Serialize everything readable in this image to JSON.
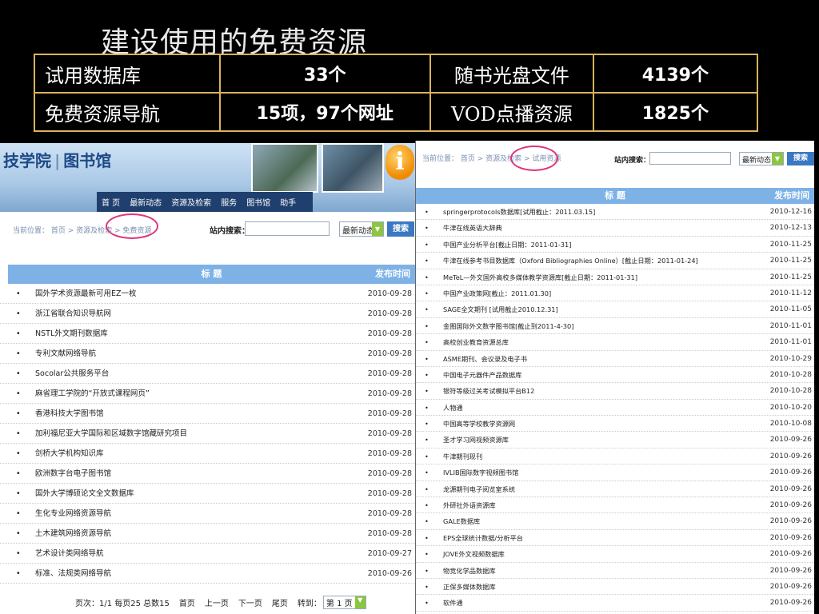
{
  "slide_title": "建设使用的免费资源",
  "stats": [
    {
      "label": "试用数据库",
      "value": "33个"
    },
    {
      "label": "随书光盘文件",
      "value": "4139个"
    },
    {
      "label": "免费资源导航",
      "value": "15项，97个网址"
    },
    {
      "label": "VOD点播资源",
      "value": "1825个"
    }
  ],
  "left": {
    "logo_text": "技学院",
    "logo_sub": "图书馆",
    "nav": [
      "首 页",
      "最新动态",
      "资源及检索",
      "服务",
      "图书馆",
      "助手"
    ],
    "breadcrumb": "当前位置： 首页 > 资源及检索 > 免费资源",
    "search_label": "站内搜索：",
    "select_value": "最新动态",
    "search_button": "搜索",
    "col_title": "标 题",
    "col_date": "发布时间",
    "rows": [
      {
        "title": "国外学术资源最新可用EZ一枚",
        "date": "2010-09-28"
      },
      {
        "title": "浙江省联合知识导航网",
        "date": "2010-09-28"
      },
      {
        "title": "NSTL外文期刊数据库",
        "date": "2010-09-28"
      },
      {
        "title": "专利文献网络导航",
        "date": "2010-09-28"
      },
      {
        "title": "Socolar公共服务平台",
        "date": "2010-09-28"
      },
      {
        "title": "麻省理工学院的“开放式课程网页”",
        "date": "2010-09-28"
      },
      {
        "title": "香港科技大学图书馆",
        "date": "2010-09-28"
      },
      {
        "title": "加利福尼亚大学国际和区域数字馆藏研究项目",
        "date": "2010-09-28"
      },
      {
        "title": "剑桥大学机构知识库",
        "date": "2010-09-28"
      },
      {
        "title": "欧洲数字台电子图书馆",
        "date": "2010-09-28"
      },
      {
        "title": "国外大学博硕论文全文数据库",
        "date": "2010-09-28"
      },
      {
        "title": "生化专业网络资源导航",
        "date": "2010-09-28"
      },
      {
        "title": "土木建筑网络资源导航",
        "date": "2010-09-28"
      },
      {
        "title": "艺术设计类网络导航",
        "date": "2010-09-27"
      },
      {
        "title": "标准、法规类网络导航",
        "date": "2010-09-26"
      }
    ],
    "pager": {
      "info": "页次：1/1 每页25 总数15",
      "first": "首页",
      "prev": "上一页",
      "next": "下一页",
      "last": "尾页",
      "goto": "转到：",
      "page_select": "第 1 页"
    }
  },
  "right": {
    "breadcrumb": "当前位置： 首页 > 资源及检索 > 试用资源",
    "search_label": "站内搜索：",
    "select_value": "最新动态",
    "search_button": "搜索",
    "col_title": "标 题",
    "col_date": "发布时间",
    "rows": [
      {
        "title": "springerprotocols数据库[试用截止：2011.03.15]",
        "date": "2010-12-16"
      },
      {
        "title": "牛津在线英语大辞典",
        "date": "2010-12-13"
      },
      {
        "title": "中国产业分析平台[截止日期：2011-01-31]",
        "date": "2010-11-25"
      },
      {
        "title": "牛津在线参考书目数据库（Oxford Bibliographies Online）[截止日期：2011-01-24]",
        "date": "2010-11-25"
      },
      {
        "title": "MeTeL—外文国外高校多媒体教学资源库[截止日期：2011-01-31]",
        "date": "2010-11-25"
      },
      {
        "title": "中国产业政策网[截止：2011.01.30]",
        "date": "2010-11-12"
      },
      {
        "title": "SAGE全文期刊 [试用截止2010.12.31]",
        "date": "2010-11-05"
      },
      {
        "title": "金图国际外文数字图书馆[截止到2011-4-30]",
        "date": "2010-11-01"
      },
      {
        "title": "高校创业教育资源总库",
        "date": "2010-11-01"
      },
      {
        "title": "ASME期刊、会议录及电子书",
        "date": "2010-10-29"
      },
      {
        "title": "中国电子元器件产品数据库",
        "date": "2010-10-28"
      },
      {
        "title": "银符等级过关考试模拟平台B12",
        "date": "2010-10-28"
      },
      {
        "title": "人物通",
        "date": "2010-10-20"
      },
      {
        "title": "中国高等学校教学资源网",
        "date": "2010-10-08"
      },
      {
        "title": "圣才学习网视频资源库",
        "date": "2010-09-26"
      },
      {
        "title": "牛津期刊现刊",
        "date": "2010-09-26"
      },
      {
        "title": "IVLIB国际数字视频图书馆",
        "date": "2010-09-26"
      },
      {
        "title": "龙源期刊电子阅览室系统",
        "date": "2010-09-26"
      },
      {
        "title": "外研社外语资源库",
        "date": "2010-09-26"
      },
      {
        "title": "GALE数据库",
        "date": "2010-09-26"
      },
      {
        "title": "EPS全球统计数据/分析平台",
        "date": "2010-09-26"
      },
      {
        "title": "JOVE外文视频数据库",
        "date": "2010-09-26"
      },
      {
        "title": "物竞化学品数据库",
        "date": "2010-09-26"
      },
      {
        "title": "正保多媒体数据库",
        "date": "2010-09-26"
      },
      {
        "title": "软件通",
        "date": "2010-09-26"
      }
    ]
  },
  "colors": {
    "background": "#000000",
    "stat_border": "#d9b25c",
    "table_header": "#7eb2e6",
    "highlight_circle": "#e0347a",
    "nav_bar": "#1f3f6e"
  }
}
